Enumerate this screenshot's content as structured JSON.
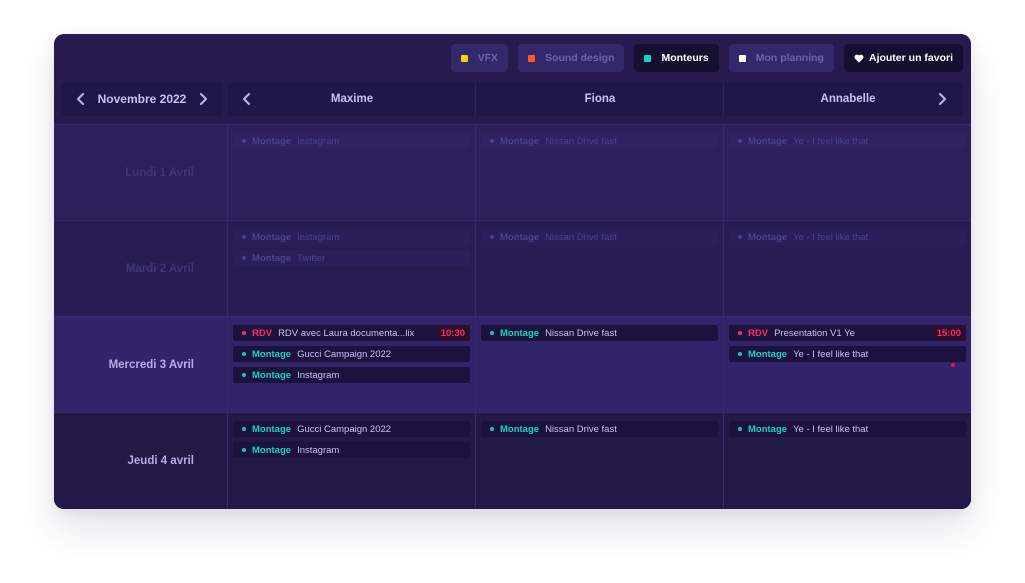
{
  "filters": [
    {
      "label": "VFX",
      "color": "#f5d400",
      "active": false
    },
    {
      "label": "Sound design",
      "color": "#ff5a1f",
      "active": false
    },
    {
      "label": "Monteurs",
      "color": "#16d3c1",
      "active": true
    },
    {
      "label": "Mon planning",
      "color": "#ffffff",
      "active": false
    }
  ],
  "favorite_label": "Ajouter un favori",
  "month": "Novembre 2022",
  "people": [
    "Maxime",
    "Fiona",
    "Annabelle"
  ],
  "days": [
    {
      "label": "Lundi 1 Avril",
      "today": false,
      "cells": [
        [
          {
            "type": "Montage",
            "title": "Instagram"
          }
        ],
        [
          {
            "type": "Montage",
            "title": "Nissan Drive fast"
          }
        ],
        [
          {
            "type": "Montage",
            "title": "Ye - I feel like that"
          }
        ]
      ]
    },
    {
      "label": "Mardi 2 Avril",
      "today": false,
      "cells": [
        [
          {
            "type": "Montage",
            "title": "Instagram"
          },
          {
            "type": "Montage",
            "title": "Twitter"
          }
        ],
        [
          {
            "type": "Montage",
            "title": "Nissan Drive fast"
          }
        ],
        [
          {
            "type": "Montage",
            "title": "Ye - I feel like that"
          }
        ]
      ]
    },
    {
      "label": "Mercredi 3 Avril",
      "today": true,
      "cells": [
        [
          {
            "type": "RDV",
            "title": "RDV avec Laura documenta...lix",
            "time": "10:30"
          },
          {
            "type": "Montage",
            "title": "Gucci Campaign 2022"
          },
          {
            "type": "Montage",
            "title": "Instagram"
          }
        ],
        [
          {
            "type": "Montage",
            "title": "Nissan Drive fast"
          }
        ],
        [
          {
            "type": "RDV",
            "title": "Presentation V1 Ye",
            "time": "15:00"
          },
          {
            "type": "Montage",
            "title": "Ye - I feel like that"
          }
        ]
      ]
    },
    {
      "label": "Jeudi 4 avril",
      "today": false,
      "cells": [
        [
          {
            "type": "Montage",
            "title": "Gucci Campaign 2022"
          },
          {
            "type": "Montage",
            "title": "Instagram"
          }
        ],
        [
          {
            "type": "Montage",
            "title": "Nissan Drive fast"
          }
        ],
        [
          {
            "type": "Montage",
            "title": "Ye - I feel like that"
          }
        ]
      ]
    }
  ],
  "colors": {
    "accent_teal": "#16d3c1",
    "rdv_red": "#ff2a5e",
    "panel_bg": "#261a4f"
  }
}
